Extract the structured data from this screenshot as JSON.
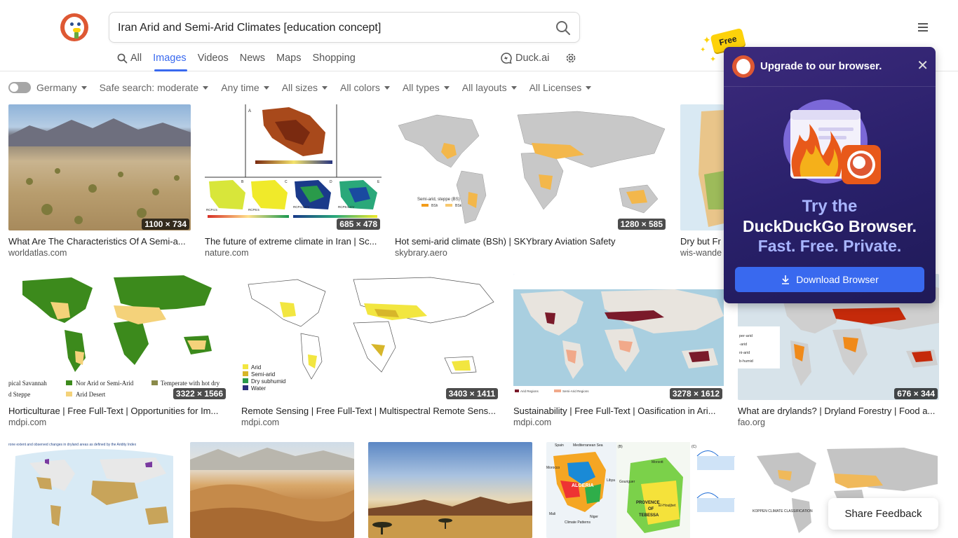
{
  "search": {
    "query": "Iran Arid and Semi-Arid Climates [education concept]"
  },
  "tabs": [
    {
      "label": "All",
      "icon": "search-icon"
    },
    {
      "label": "Images"
    },
    {
      "label": "Videos"
    },
    {
      "label": "News"
    },
    {
      "label": "Maps"
    },
    {
      "label": "Shopping"
    }
  ],
  "active_tab": "Images",
  "duckai": {
    "label": "Duck.ai"
  },
  "filters": [
    {
      "label": "Germany"
    },
    {
      "label": "Safe search: moderate"
    },
    {
      "label": "Any time"
    },
    {
      "label": "All sizes"
    },
    {
      "label": "All colors"
    },
    {
      "label": "All types"
    },
    {
      "label": "All layouts"
    },
    {
      "label": "All Licenses"
    }
  ],
  "results": [
    {
      "title": "What Are The Characteristics Of A Semi-a...",
      "domain": "worldatlas.com",
      "dims": "1100 × 734"
    },
    {
      "title": "The future of extreme climate in Iran | Sc...",
      "domain": "nature.com",
      "dims": "685 × 478"
    },
    {
      "title": "Hot semi-arid climate (BSh) | SKYbrary Aviation Safety",
      "domain": "skybrary.aero",
      "dims": "1280 × 585"
    },
    {
      "title": "Dry but Fr",
      "domain": "wis-wande",
      "dims": ""
    },
    {
      "title": "Horticulturae | Free Full-Text | Opportunities for Im...",
      "domain": "mdpi.com",
      "dims": "3322 × 1566"
    },
    {
      "title": "Remote Sensing | Free Full-Text | Multispectral Remote Sens...",
      "domain": "mdpi.com",
      "dims": "3403 × 1411"
    },
    {
      "title": "Sustainability | Free Full-Text | Oasification in Ari...",
      "domain": "mdpi.com",
      "dims": "3278 × 1612"
    },
    {
      "title": "What are drylands? | Dryland Forestry | Food a...",
      "domain": "fao.org",
      "dims": "676 × 344"
    }
  ],
  "image_text": {
    "r2_legend": [
      "Arid",
      "Semi-arid",
      "Dry subhumid",
      "Water"
    ],
    "r1_semi": "Semi-arid, steppe (BS)",
    "r1_bsh": "BSh",
    "r1_bsk": "BSk",
    "r1_a": "A",
    "r1_labels": [
      "B",
      "C",
      "D",
      "E"
    ],
    "r1_rcp": [
      "RCP4.5",
      "RCP8.5",
      "RCP4.5 CV",
      "RCP8.5 CV"
    ],
    "r2_mdpi_legend": [
      "pical Savannah",
      "d Steppe",
      "Nor Arid or Semi-Arid",
      "Arid Desert",
      "Temperate with hot dry"
    ],
    "r2_oas_legend": [
      "Arid Regions",
      "Semi-Arid Regions"
    ],
    "r2_fao": [
      "per-arid",
      "-arid",
      "ni-arid",
      "b-humid"
    ],
    "r3_title": "rone extent and observed changes in dryland areas as defined by the Aridity Index",
    "r3_koppen": "KOPPEN CLIMATE CLASSIFICATION",
    "r3_alg": [
      "Spain",
      "Mediterranean Sea",
      "Morocco",
      "ALGERIA",
      "Libya",
      "Mali",
      "Niger",
      "Climate Patterns",
      "PROVENCE",
      "OF",
      "TEBESSA",
      "(B)",
      "(C)",
      "Morsott",
      "El-Houijbet",
      "Gouriguer"
    ]
  },
  "promo": {
    "header": "Upgrade to our browser.",
    "line1": "Try the",
    "line2": "DuckDuckGo Browser.",
    "line3": "Fast. Free. Private.",
    "button": "Download Browser",
    "badge": "Free"
  },
  "feedback": {
    "label": "Share Feedback"
  },
  "colors": {
    "accent": "#3969ef",
    "brand": "#de5833",
    "promo_bg": "#29206a"
  }
}
